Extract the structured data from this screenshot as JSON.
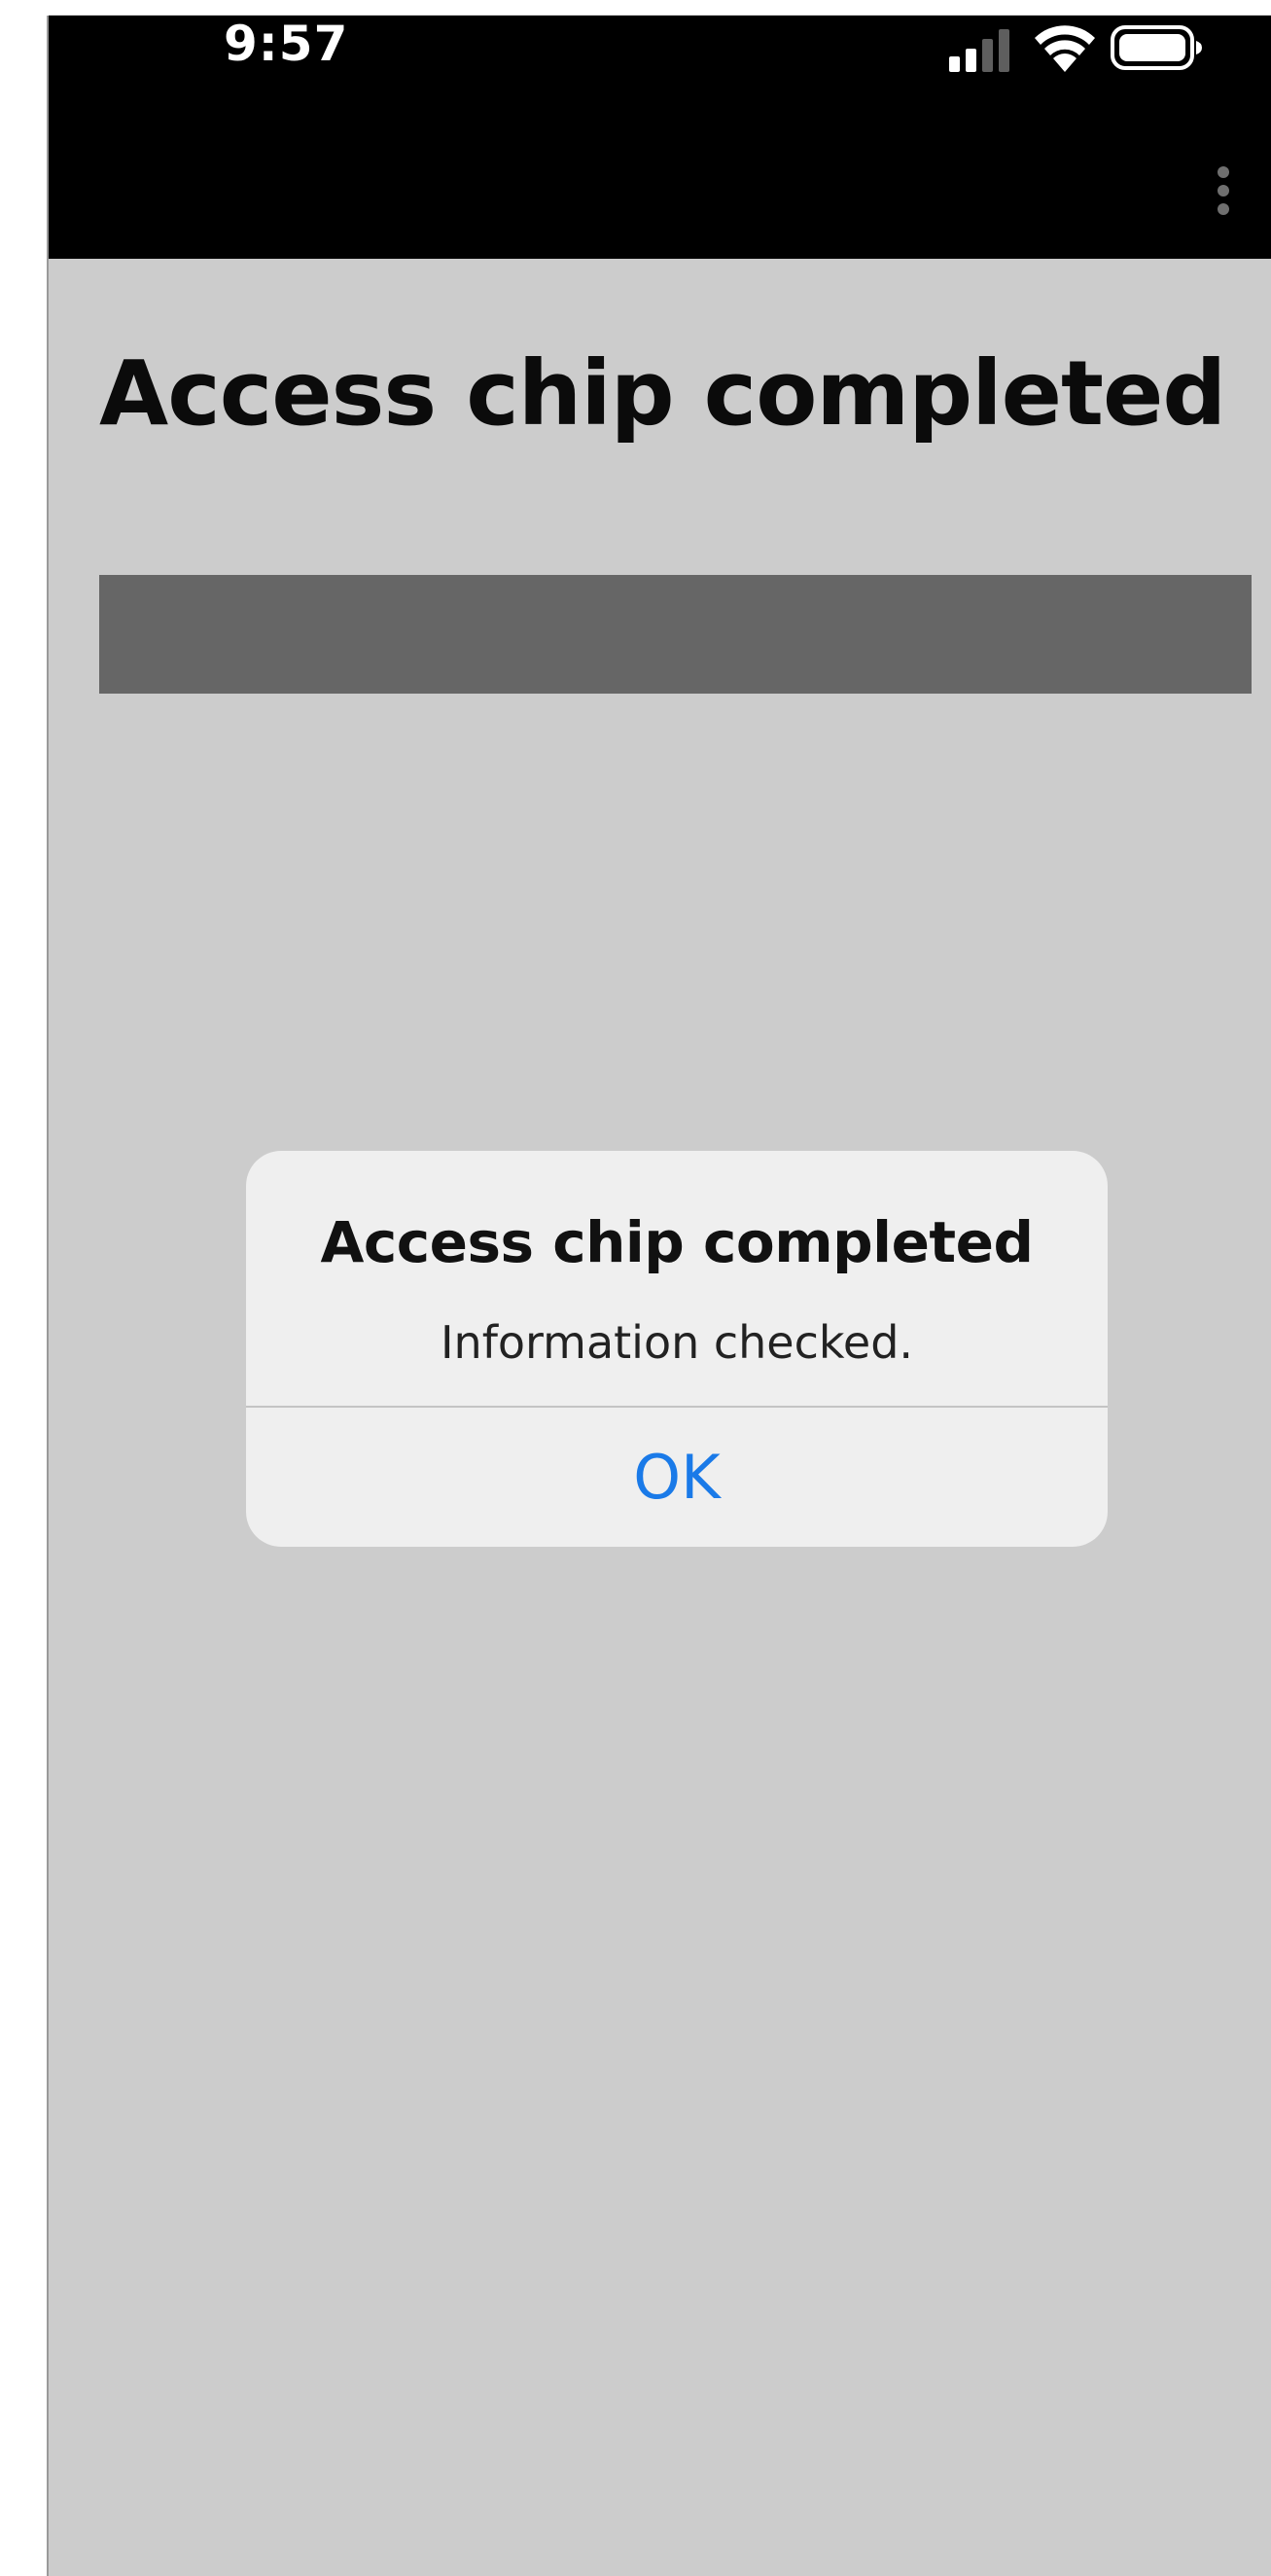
{
  "status_bar": {
    "time": "9:57",
    "icons": [
      "signal-icon",
      "wifi-icon",
      "battery-icon"
    ]
  },
  "app_bar": {
    "menu_icon": "more-vertical-icon"
  },
  "page": {
    "title": "Access chip completed"
  },
  "dialog": {
    "title": "Access chip completed",
    "message": "Information checked.",
    "ok_label": "OK"
  },
  "colors": {
    "status_bar_bg": "#000000",
    "page_bg": "#cccccc",
    "progress_bar": "#666666",
    "dialog_bg": "#efefef",
    "link_blue": "#1a7ae8"
  }
}
